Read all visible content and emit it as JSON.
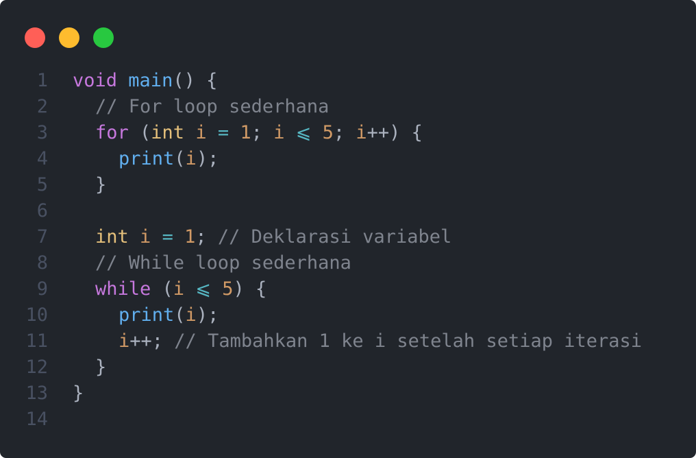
{
  "window": {
    "controls": [
      {
        "name": "close",
        "color": "#ff5f57"
      },
      {
        "name": "minimize",
        "color": "#febc2e"
      },
      {
        "name": "maximize",
        "color": "#28c840"
      }
    ]
  },
  "editor": {
    "language": "dart",
    "lines": [
      {
        "number": "1",
        "indent": 0,
        "tokens": [
          {
            "text": "void",
            "kind": "kw"
          },
          {
            "text": " ",
            "kind": "pn"
          },
          {
            "text": "main",
            "kind": "fn"
          },
          {
            "text": "() {",
            "kind": "pn"
          }
        ]
      },
      {
        "number": "2",
        "indent": 1,
        "tokens": [
          {
            "text": "// For loop sederhana",
            "kind": "cm"
          }
        ]
      },
      {
        "number": "3",
        "indent": 1,
        "tokens": [
          {
            "text": "for",
            "kind": "kw"
          },
          {
            "text": " (",
            "kind": "pn"
          },
          {
            "text": "int",
            "kind": "type"
          },
          {
            "text": " ",
            "kind": "pn"
          },
          {
            "text": "i",
            "kind": "var"
          },
          {
            "text": " ",
            "kind": "pn"
          },
          {
            "text": "=",
            "kind": "op"
          },
          {
            "text": " ",
            "kind": "pn"
          },
          {
            "text": "1",
            "kind": "num"
          },
          {
            "text": "; ",
            "kind": "pn"
          },
          {
            "text": "i",
            "kind": "var"
          },
          {
            "text": " ",
            "kind": "pn"
          },
          {
            "text": "⩽",
            "kind": "op"
          },
          {
            "text": " ",
            "kind": "pn"
          },
          {
            "text": "5",
            "kind": "num"
          },
          {
            "text": "; ",
            "kind": "pn"
          },
          {
            "text": "i",
            "kind": "var"
          },
          {
            "text": "++",
            "kind": "pn"
          },
          {
            "text": ") {",
            "kind": "pn"
          }
        ]
      },
      {
        "number": "4",
        "indent": 2,
        "tokens": [
          {
            "text": "print",
            "kind": "fn"
          },
          {
            "text": "(",
            "kind": "pn"
          },
          {
            "text": "i",
            "kind": "var"
          },
          {
            "text": ");",
            "kind": "pn"
          }
        ]
      },
      {
        "number": "5",
        "indent": 1,
        "tokens": [
          {
            "text": "}",
            "kind": "pn"
          }
        ]
      },
      {
        "number": "6",
        "indent": 0,
        "tokens": []
      },
      {
        "number": "7",
        "indent": 1,
        "tokens": [
          {
            "text": "int",
            "kind": "type"
          },
          {
            "text": " ",
            "kind": "pn"
          },
          {
            "text": "i",
            "kind": "var"
          },
          {
            "text": " ",
            "kind": "pn"
          },
          {
            "text": "=",
            "kind": "op"
          },
          {
            "text": " ",
            "kind": "pn"
          },
          {
            "text": "1",
            "kind": "num"
          },
          {
            "text": "; ",
            "kind": "pn"
          },
          {
            "text": "// Deklarasi variabel",
            "kind": "cm"
          }
        ]
      },
      {
        "number": "8",
        "indent": 1,
        "tokens": [
          {
            "text": "// While loop sederhana",
            "kind": "cm"
          }
        ]
      },
      {
        "number": "9",
        "indent": 1,
        "tokens": [
          {
            "text": "while",
            "kind": "kw"
          },
          {
            "text": " (",
            "kind": "pn"
          },
          {
            "text": "i",
            "kind": "var"
          },
          {
            "text": " ",
            "kind": "pn"
          },
          {
            "text": "⩽",
            "kind": "op"
          },
          {
            "text": " ",
            "kind": "pn"
          },
          {
            "text": "5",
            "kind": "num"
          },
          {
            "text": ") {",
            "kind": "pn"
          }
        ]
      },
      {
        "number": "10",
        "indent": 2,
        "tokens": [
          {
            "text": "print",
            "kind": "fn"
          },
          {
            "text": "(",
            "kind": "pn"
          },
          {
            "text": "i",
            "kind": "var"
          },
          {
            "text": ");",
            "kind": "pn"
          }
        ]
      },
      {
        "number": "11",
        "indent": 2,
        "tokens": [
          {
            "text": "i",
            "kind": "var"
          },
          {
            "text": "++; ",
            "kind": "pn"
          },
          {
            "text": "// Tambahkan 1 ke i setelah setiap iterasi",
            "kind": "cm"
          }
        ]
      },
      {
        "number": "12",
        "indent": 1,
        "tokens": [
          {
            "text": "}",
            "kind": "pn"
          }
        ]
      },
      {
        "number": "13",
        "indent": 0,
        "tokens": [
          {
            "text": "}",
            "kind": "pn"
          }
        ]
      },
      {
        "number": "14",
        "indent": 0,
        "tokens": []
      }
    ]
  },
  "theme": {
    "background": "#21252b",
    "line_number": "#495162",
    "keyword": "#c678dd",
    "type": "#e5c07b",
    "function": "#61afef",
    "number": "#d19a66",
    "operator": "#56b6c2",
    "comment": "#7f848e",
    "punctuation": "#abb2bf"
  }
}
